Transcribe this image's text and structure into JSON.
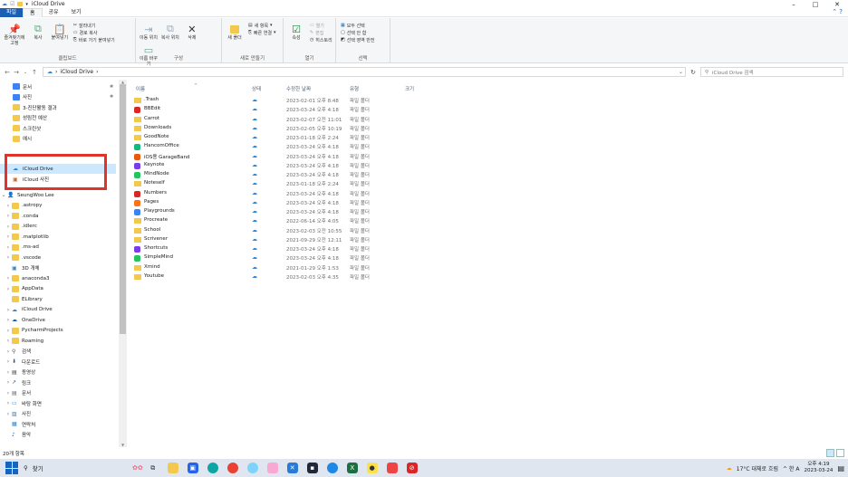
{
  "window": {
    "title": "iCloud Drive",
    "controls": {
      "minimize": "–",
      "maximize": "□",
      "close": "✕"
    }
  },
  "ribbon_tabs": [
    "파일",
    "홈",
    "공유",
    "보기"
  ],
  "ribbon": {
    "clipboard": {
      "pin_quick": "즐겨찾기에 고정",
      "copy": "복사",
      "paste": "붙여넣기",
      "cut": "잘라내기",
      "copy_path": "경로 복사",
      "paste_shortcut": "바로 가기 붙여넣기",
      "label": "클립보드"
    },
    "organize": {
      "move_to": "이동 위치",
      "copy_to": "복사 위치",
      "delete": "삭제",
      "rename": "이름 바꾸기",
      "label": "구성"
    },
    "new": {
      "new_folder": "새 폴더",
      "new_item": "새 항목",
      "easy_access": "빠른 연결",
      "label": "새로 만들기"
    },
    "open": {
      "properties": "속성",
      "open": "열기",
      "edit": "편집",
      "history": "히스토리",
      "label": "열기"
    },
    "select": {
      "select_all": "모두 선택",
      "select_none": "선택 안 함",
      "invert": "선택 영역 반전",
      "label": "선택"
    }
  },
  "address": {
    "path": "iCloud Drive",
    "sep": "›",
    "search_placeholder": "iCloud Drive 검색"
  },
  "nav_pane": {
    "quick": [
      {
        "label": "문서",
        "pinned": true
      },
      {
        "label": "사진",
        "pinned": true
      },
      {
        "label": "3-진단활동 결과"
      },
      {
        "label": "성림천 예산"
      },
      {
        "label": "스크린샷"
      },
      {
        "label": "예시"
      }
    ],
    "cloud": [
      {
        "label": "iCloud Drive",
        "selected": true
      },
      {
        "label": "iCloud 사진"
      }
    ],
    "user": "SeungWoo Lee",
    "user_items": [
      ".astropy",
      ".conda",
      ".idlerc",
      ".matplotlib",
      ".ms-ad",
      ".vscode",
      "3D 개체",
      "anaconda3",
      "AppData",
      "ELibrary",
      "iCloud Drive",
      "OneDrive",
      "PycharmProjects",
      "Roaming",
      "검색",
      "다운로드",
      "동영상",
      "링크",
      "문서",
      "바탕 화면",
      "사진",
      "연락처",
      "음악"
    ]
  },
  "columns": {
    "name": "이름",
    "status": "상태",
    "modified": "수정한 날짜",
    "type": "유형",
    "size": "크기"
  },
  "files": [
    {
      "name": ".Trash",
      "modified": "2023-02-01 오후 8:48",
      "type": "파일 폴더",
      "icon": "folder"
    },
    {
      "name": "BBEdit",
      "modified": "2023-03-24 오후 4:18",
      "type": "파일 폴더",
      "icon": "app"
    },
    {
      "name": "Carrot",
      "modified": "2023-02-07 오전 11:01",
      "type": "파일 폴더",
      "icon": "folder"
    },
    {
      "name": "Downloads",
      "modified": "2023-02-05 오후 10:19",
      "type": "파일 폴더",
      "icon": "folder"
    },
    {
      "name": "GoodNote",
      "modified": "2023-01-18 오후 2:24",
      "type": "파일 폴더",
      "icon": "folder"
    },
    {
      "name": "HancomOffice",
      "modified": "2023-03-24 오후 4:18",
      "type": "파일 폴더",
      "icon": "app"
    },
    {
      "name": "iOS용 GarageBand",
      "modified": "2023-03-24 오후 4:18",
      "type": "파일 폴더",
      "icon": "app"
    },
    {
      "name": "Keynote",
      "modified": "2023-03-24 오후 4:18",
      "type": "파일 폴더",
      "icon": "app"
    },
    {
      "name": "MindNode",
      "modified": "2023-03-24 오후 4:18",
      "type": "파일 폴더",
      "icon": "app"
    },
    {
      "name": "Noteself",
      "modified": "2023-01-18 오후 2:24",
      "type": "파일 폴더",
      "icon": "folder"
    },
    {
      "name": "Numbers",
      "modified": "2023-03-24 오후 4:18",
      "type": "파일 폴더",
      "icon": "app"
    },
    {
      "name": "Pages",
      "modified": "2023-03-24 오후 4:18",
      "type": "파일 폴더",
      "icon": "app"
    },
    {
      "name": "Playgrounds",
      "modified": "2023-03-24 오후 4:18",
      "type": "파일 폴더",
      "icon": "app"
    },
    {
      "name": "Procreate",
      "modified": "2022-06-14 오후 4:05",
      "type": "파일 폴더",
      "icon": "folder"
    },
    {
      "name": "School",
      "modified": "2023-02-03 오전 10:55",
      "type": "파일 폴더",
      "icon": "folder"
    },
    {
      "name": "Scrivener",
      "modified": "2021-09-29 오전 12:11",
      "type": "파일 폴더",
      "icon": "folder"
    },
    {
      "name": "Shortcuts",
      "modified": "2023-03-24 오후 4:18",
      "type": "파일 폴더",
      "icon": "app"
    },
    {
      "name": "SimpleMind",
      "modified": "2023-03-24 오후 4:18",
      "type": "파일 폴더",
      "icon": "app"
    },
    {
      "name": "Xmind",
      "modified": "2021-01-29 오후 1:53",
      "type": "파일 폴더",
      "icon": "folder"
    },
    {
      "name": "Youtube",
      "modified": "2023-02-03 오후 4:35",
      "type": "파일 폴더",
      "icon": "folder"
    }
  ],
  "statusbar": {
    "count": "20개 항목"
  },
  "taskbar": {
    "search": "찾기",
    "weather": "17°C 대체로 흐림",
    "tray": "^ 한 A",
    "time": "오후 4:19",
    "date": "2023-03-24"
  },
  "colors": {
    "accent": "#1a5fb4",
    "selection": "#cce8ff",
    "highlight_box": "#e0342a",
    "folder": "#f2c94c"
  }
}
